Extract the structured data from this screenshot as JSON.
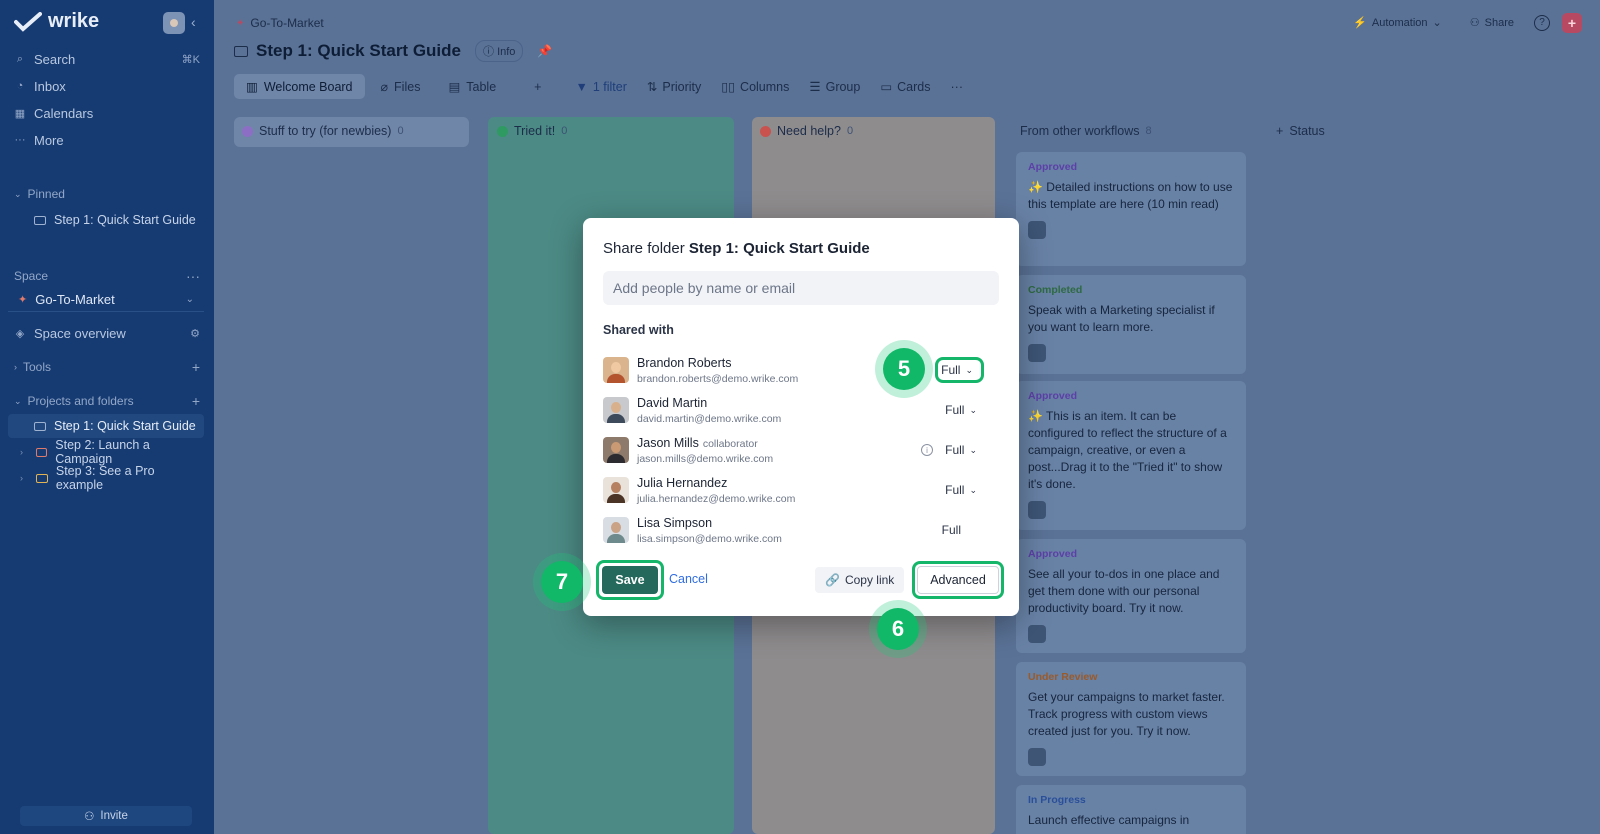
{
  "sidebar": {
    "logo": "wrike",
    "nav": [
      {
        "label": "Search",
        "shortcut": "⌘K"
      },
      {
        "label": "Inbox"
      },
      {
        "label": "Calendars"
      },
      {
        "label": "More"
      }
    ],
    "pinned_label": "Pinned",
    "pinned_items": [
      "Step 1: Quick Start Guide"
    ],
    "space_label": "Space",
    "space_name": "Go-To-Market",
    "space_overview": "Space overview",
    "tools": "Tools",
    "projects_label": "Projects and folders",
    "folders": [
      "Step 1: Quick Start Guide",
      "Step 2: Launch a Campaign",
      "Step 3: See a Pro example"
    ],
    "invite": "Invite"
  },
  "header": {
    "breadcrumb": "Go-To-Market",
    "title": "Step 1: Quick Start Guide",
    "info": "Info",
    "automation": "Automation",
    "share": "Share"
  },
  "toolbar": {
    "tabs": [
      "Welcome Board",
      "Files",
      "Table"
    ],
    "filter": "1 filter",
    "priority": "Priority",
    "columns": "Columns",
    "group": "Group",
    "cards": "Cards"
  },
  "board": {
    "columns": [
      {
        "name": "Stuff to try (for newbies)",
        "count": "0",
        "color": "#8c6fc4"
      },
      {
        "name": "Tried it!",
        "count": "0",
        "color": "#2f9a62"
      },
      {
        "name": "Need help?",
        "count": "0",
        "color": "#c9524e"
      },
      {
        "name": "From other workflows",
        "count": "8"
      }
    ],
    "add_status": "Status",
    "cards": [
      {
        "status": "Approved",
        "status_color": "#5d3fa8",
        "text": "✨ Detailed instructions on how to use this template are here (10 min read)"
      },
      {
        "status": "Completed",
        "status_color": "#2e6a42",
        "text": "Speak with a Marketing specialist if you want to learn more."
      },
      {
        "status": "Approved",
        "status_color": "#5d3fa8",
        "text": "✨ This is an item. It can be configured to reflect the structure of a campaign, creative, or even a post...Drag it to the \"Tried it\" to show it's done."
      },
      {
        "status": "Approved",
        "status_color": "#5d3fa8",
        "text": "See all your to-dos in one place and get them done with our personal productivity board. Try it now."
      },
      {
        "status": "Under Review",
        "status_color": "#9a5a2a",
        "text": "Get your campaigns to market faster. Track progress with custom views created just for you. Try it now."
      },
      {
        "status": "In Progress",
        "status_color": "#2a4f9a",
        "text": "Launch effective campaigns in"
      }
    ]
  },
  "dialog": {
    "title_prefix": "Share folder ",
    "title_name": "Step 1: Quick Start Guide",
    "input_placeholder": "Add people by name or email",
    "shared_with": "Shared with",
    "people": [
      {
        "name": "Brandon Roberts",
        "tag": "",
        "email": "brandon.roberts@demo.wrike.com",
        "role": "Full",
        "dropdown": true
      },
      {
        "name": "David Martin",
        "tag": "",
        "email": "david.martin@demo.wrike.com",
        "role": "Full",
        "dropdown": true
      },
      {
        "name": "Jason Mills",
        "tag": "collaborator",
        "email": "jason.mills@demo.wrike.com",
        "role": "Full",
        "dropdown": true
      },
      {
        "name": "Julia Hernandez",
        "tag": "",
        "email": "julia.hernandez@demo.wrike.com",
        "role": "Full",
        "dropdown": true
      },
      {
        "name": "Lisa Simpson",
        "tag": "",
        "email": "lisa.simpson@demo.wrike.com",
        "role": "Full",
        "dropdown": false
      }
    ],
    "save": "Save",
    "cancel": "Cancel",
    "copy_link": "Copy link",
    "advanced": "Advanced"
  },
  "markers": [
    "5",
    "6",
    "7"
  ],
  "colors": {
    "accent_green": "#15b56a",
    "save_button": "#24695b",
    "link_blue": "#2f6de1"
  }
}
